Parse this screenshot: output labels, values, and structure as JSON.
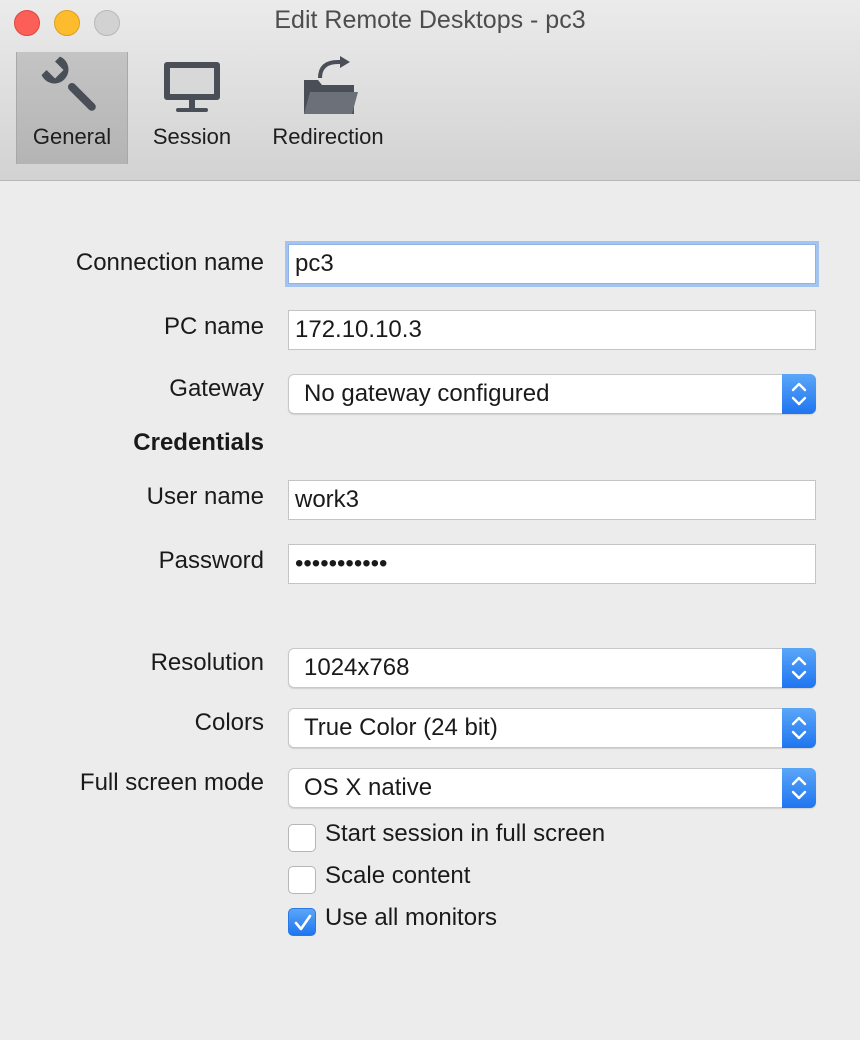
{
  "window": {
    "title": "Edit Remote Desktops - pc3"
  },
  "toolbar": {
    "tabs": [
      {
        "label": "General",
        "icon": "wrench-icon",
        "selected": true
      },
      {
        "label": "Session",
        "icon": "monitor-icon",
        "selected": false
      },
      {
        "label": "Redirection",
        "icon": "folder-redirect-icon",
        "selected": false
      }
    ]
  },
  "form": {
    "connection_name": {
      "label": "Connection name",
      "value": "pc3"
    },
    "pc_name": {
      "label": "PC name",
      "value": "172.10.10.3"
    },
    "gateway": {
      "label": "Gateway",
      "value": "No gateway configured"
    },
    "credentials_heading": "Credentials",
    "user_name": {
      "label": "User name",
      "value": "work3"
    },
    "password": {
      "label": "Password",
      "value": "•••••••••••"
    },
    "resolution": {
      "label": "Resolution",
      "value": "1024x768"
    },
    "colors": {
      "label": "Colors",
      "value": "True Color (24 bit)"
    },
    "full_screen_mode": {
      "label": "Full screen mode",
      "value": "OS X native"
    },
    "checkboxes": [
      {
        "label": "Start session in full screen",
        "checked": false
      },
      {
        "label": "Scale content",
        "checked": false
      },
      {
        "label": "Use all monitors",
        "checked": true
      }
    ]
  },
  "colors": {
    "accent": "#1f75f0",
    "close": "#fc5f57",
    "minimize": "#fdbc2e",
    "zoom_disabled": "#d2d2d2",
    "focus_ring": "#a3c4f0"
  }
}
